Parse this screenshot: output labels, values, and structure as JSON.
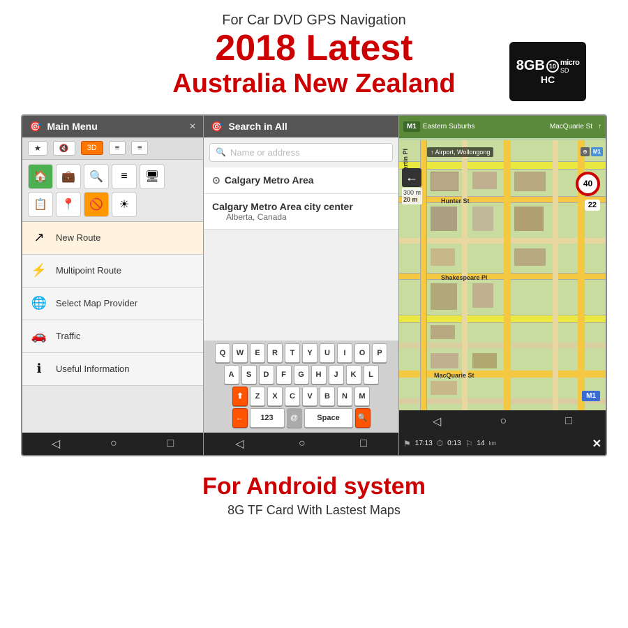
{
  "header": {
    "subtitle": "For Car DVD GPS Navigation",
    "year": "2018 Latest",
    "region": "Australia New Zealand"
  },
  "sdcard": {
    "gb": "8GB",
    "class_label": "10",
    "brand": "micro",
    "type": "SD",
    "hc": "HC"
  },
  "left_panel": {
    "title": "Main Menu",
    "toolbar_items": [
      "★",
      "🔇",
      "3D",
      "≡",
      "≡"
    ],
    "icon_rows": [
      [
        "🏠",
        "💼",
        "🔍",
        "≡",
        "🖥"
      ],
      [
        "📋",
        "📍",
        "🚫",
        "☀"
      ]
    ],
    "menu_items": [
      {
        "icon": "↗",
        "label": "New Route"
      },
      {
        "icon": "⚡",
        "label": "Multipoint Route"
      },
      {
        "icon": "🌐",
        "label": "Select Map Provider"
      },
      {
        "icon": "🚗",
        "label": "Traffic"
      },
      {
        "icon": "ℹ",
        "label": "Useful Information"
      }
    ]
  },
  "mid_panel": {
    "title": "Search in All",
    "search_placeholder": "Name or address",
    "results": [
      {
        "name": "Calgary Metro Area",
        "sub": ""
      },
      {
        "name": "Calgary Metro Area city center",
        "sub": "Alberta, Canada"
      }
    ],
    "keyboard_rows": [
      [
        "Q",
        "W",
        "E",
        "R",
        "T",
        "Y",
        "U",
        "I",
        "O",
        "P"
      ],
      [
        "A",
        "S",
        "D",
        "F",
        "G",
        "H",
        "J",
        "K",
        "L"
      ],
      [
        "Z",
        "X",
        "C",
        "V",
        "B",
        "N",
        "M"
      ],
      [
        "123",
        "Space"
      ]
    ]
  },
  "right_panel": {
    "highway": "M1",
    "area": "Eastern Suburbs",
    "street": "MacQuarie St",
    "destination": "Airport, Wollongong",
    "speed_limit": "40",
    "distance_label": "300 m",
    "distance_m": "20 m",
    "time": "17:13",
    "trip_time": "0:13",
    "remaining": "14"
  },
  "footer": {
    "android": "For Android system",
    "desc": "8G TF Card With Lastest Maps"
  }
}
